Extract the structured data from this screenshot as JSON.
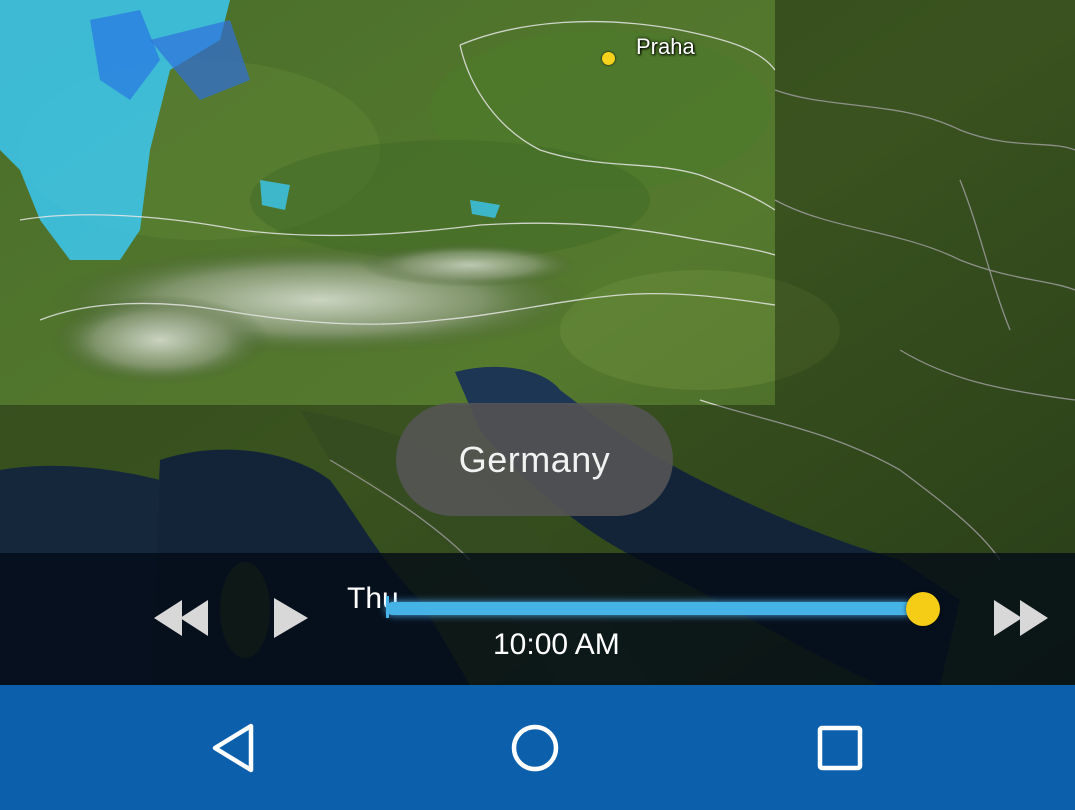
{
  "map": {
    "city_label": "Praha",
    "city_dot_color": "#f7d21c",
    "icon": "map-terrain-background"
  },
  "toast": {
    "text": "Germany"
  },
  "player": {
    "day_label": "Thu",
    "time_label": "10:00 AM",
    "progress": 1.0,
    "track_color": "#45b3e6",
    "thumb_color": "#f5cc16",
    "icons": {
      "rewind": "rewind-icon",
      "play": "play-icon",
      "fast_forward": "fast-forward-icon"
    }
  },
  "navbar": {
    "color": "#0b5fab",
    "icons": {
      "back": "back-icon",
      "home": "home-icon",
      "recents": "recents-icon"
    }
  }
}
